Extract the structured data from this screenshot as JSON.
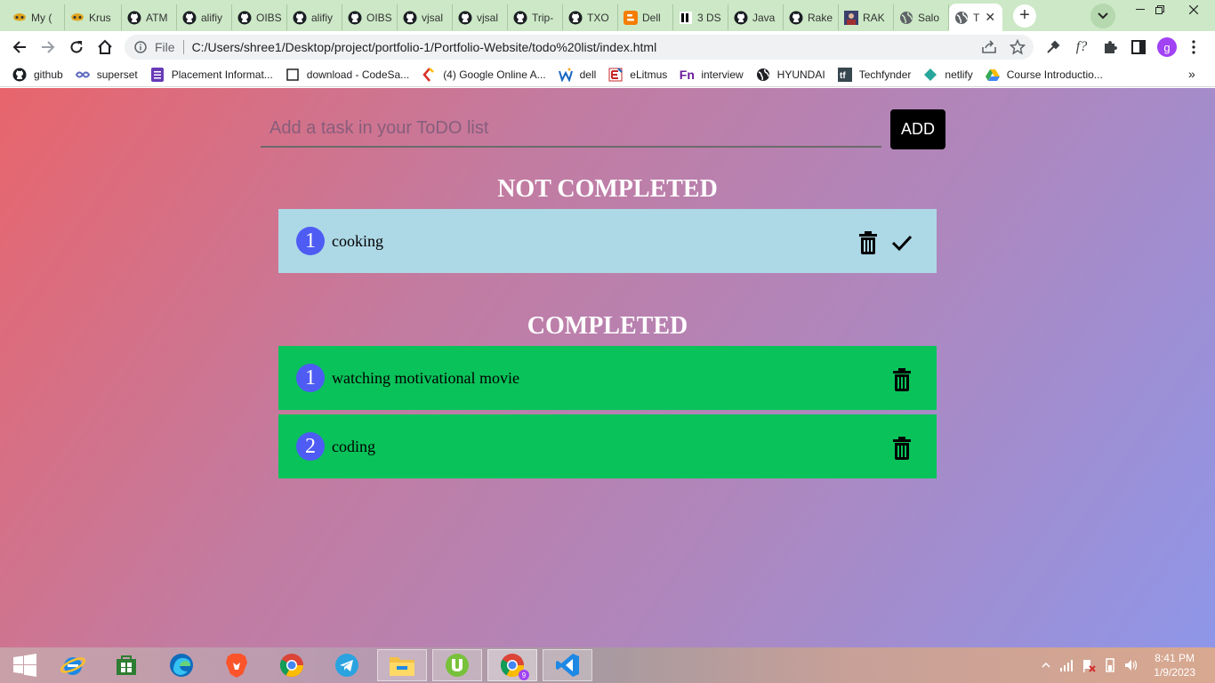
{
  "tabs": [
    {
      "label": "My (",
      "icon": "mask-icon"
    },
    {
      "label": "Krus",
      "icon": "mask-icon"
    },
    {
      "label": "ATM",
      "icon": "github-icon"
    },
    {
      "label": "alifiy",
      "icon": "github-icon"
    },
    {
      "label": "OIBS",
      "icon": "github-icon"
    },
    {
      "label": "alifiy",
      "icon": "github-icon"
    },
    {
      "label": "OIBS",
      "icon": "github-icon"
    },
    {
      "label": "vjsal",
      "icon": "github-icon"
    },
    {
      "label": "vjsal",
      "icon": "github-icon"
    },
    {
      "label": "Trip-",
      "icon": "github-icon"
    },
    {
      "label": "TXO",
      "icon": "github-icon"
    },
    {
      "label": "Dell",
      "icon": "blogger-icon"
    },
    {
      "label": "3 DS",
      "icon": "site-icon"
    },
    {
      "label": "Java",
      "icon": "github-icon"
    },
    {
      "label": "Rake",
      "icon": "github-icon"
    },
    {
      "label": "RAK",
      "icon": "avatar-icon"
    },
    {
      "label": "Salo",
      "icon": "globe-icon"
    },
    {
      "label": "T",
      "icon": "globe-icon",
      "active": true
    }
  ],
  "address": {
    "prefix": "File",
    "url": "C:/Users/shree1/Desktop/project/portfolio-1/Portfolio-Website/todo%20list/index.html"
  },
  "profile_initial": "g",
  "bookmarks": [
    {
      "label": "github",
      "icon": "github-icon"
    },
    {
      "label": "superset",
      "icon": "superset-icon"
    },
    {
      "label": "Placement Informat...",
      "icon": "form-icon"
    },
    {
      "label": "download - CodeSa...",
      "icon": "page-icon"
    },
    {
      "label": "(4) Google Online A...",
      "icon": "codesandbox-icon"
    },
    {
      "label": "dell",
      "icon": "w-icon"
    },
    {
      "label": "eLitmus",
      "icon": "elitmus-icon"
    },
    {
      "label": "interview",
      "icon": "fn-icon"
    },
    {
      "label": "HYUNDAI",
      "icon": "globe-icon"
    },
    {
      "label": "Techfynder",
      "icon": "tf-icon"
    },
    {
      "label": "netlify",
      "icon": "netlify-icon"
    },
    {
      "label": "Course Introductio...",
      "icon": "drive-icon"
    }
  ],
  "todo": {
    "input_placeholder": "Add a task in your ToDO list",
    "add_label": "ADD",
    "not_completed_title": "NOT COMPLETED",
    "completed_title": "COMPLETED",
    "not_completed": [
      {
        "num": "1",
        "text": "cooking"
      }
    ],
    "completed": [
      {
        "num": "1",
        "text": "watching motivational movie"
      },
      {
        "num": "2",
        "text": "coding"
      }
    ]
  },
  "taskbar": {
    "time": "8:41 PM",
    "date": "1/9/2023",
    "chrome_badge": "9"
  },
  "colors": {
    "not_completed_bg": "#add8e6",
    "completed_bg": "#09c35a",
    "number_badge": "#4e5cf4",
    "add_button": "#000000",
    "tab_strip": "#cce8c6"
  }
}
